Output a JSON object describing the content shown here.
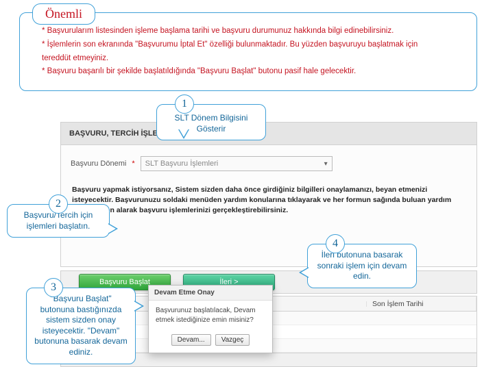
{
  "important": {
    "label": "Önemli",
    "line1": "* Başvurularım listesinden işleme başlama tarihi ve başvuru durumunuz hakkında bilgi edinebilirsiniz.",
    "line2": "* İşlemlerin son ekranında \"Başvurumu İptal Et\" özelliği bulunmaktadır. Bu yüzden başvuruyu başlatmak için",
    "line2b": "  tereddüt etmeyiniz.",
    "line3": "* Başvuru başarılı bir şekilde başlatıldığında \"Başvuru Başlat\" butonu pasif hale gelecektir."
  },
  "panel": {
    "title": "BAŞVURU, TERCİH İŞLEMLERİ",
    "fieldLabel": "Başvuru Dönemi",
    "selectValue": "SLT Başvuru İşlemleri",
    "info": "Başvuru yapmak istiyorsanız, Sistem sizden daha önce girdiğiniz bilgilleri onaylamanızı,  beyan etmenizi isteyecektir. Başvurunuzu soldaki menüden yardım konularına tıklayarak ve her formun sağında buluan yardım listelerinden alarak başvuru işlemlerinizi gerçekleştirebilirsiniz."
  },
  "toolbar": {
    "start": "Başvuru Başlat",
    "next": "İleri >"
  },
  "grid": {
    "colA": "",
    "colB": "",
    "colC": "Son İşlem Tarihi"
  },
  "callouts": {
    "c1": "SLT Dönem Bilgisini Gösterir",
    "c2": "Başvuru/Tercih için işlemleri başlatın.",
    "c3": "\"Başvuru Başlat\" butonuna bastığınızda sistem sizden onay isteyecektir. \"Devam\" butonuna basarak devam ediniz.",
    "c4": "İleri butonuna basarak sonraki işlem için devam edin."
  },
  "dialog": {
    "title": "Devam Etme Onay",
    "body": "Başvurunuz başlatılacak, Devam etmek istediğinize emin misiniz?",
    "ok": "Devam...",
    "cancel": "Vazgeç"
  }
}
